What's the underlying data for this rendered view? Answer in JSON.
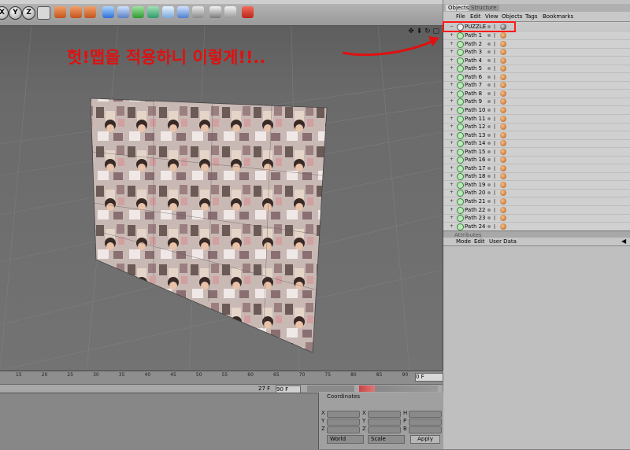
{
  "toolbar": {
    "axis_buttons": [
      "X",
      "Y",
      "Z"
    ]
  },
  "annotation": {
    "text": "헛!맵을 적용하니 이렇게!!.."
  },
  "colors": {
    "annotation": "#e01010",
    "highlight_box": "#ff1a1a",
    "path_icon": "#2f8a2f"
  },
  "object_manager": {
    "tabs": [
      "Objects",
      "Structure"
    ],
    "menu": [
      "File",
      "Edit",
      "View",
      "Objects",
      "Tags",
      "Bookmarks"
    ],
    "root": "PUZZLE",
    "items": [
      "Path 1",
      "Path 2",
      "Path 3",
      "Path 4",
      "Path 5",
      "Path 6",
      "Path 7",
      "Path 8",
      "Path 9",
      "Path 10",
      "Path 11",
      "Path 12",
      "Path 13",
      "Path 14",
      "Path 15",
      "Path 16",
      "Path 17",
      "Path 18",
      "Path 19",
      "Path 20",
      "Path 21",
      "Path 22",
      "Path 23",
      "Path 24"
    ]
  },
  "attributes": {
    "title": "Attributes",
    "menu": [
      "Mode",
      "Edit",
      "User Data"
    ]
  },
  "timeline": {
    "ticks": [
      "15",
      "20",
      "25",
      "30",
      "35",
      "40",
      "45",
      "50",
      "55",
      "60",
      "65",
      "70",
      "75",
      "80",
      "85",
      "90"
    ],
    "current_frame": "0 F",
    "end_frame": "90 F",
    "range": "27 F"
  },
  "coordinates": {
    "title": "Coordinates",
    "pos_labels": [
      "X",
      "Y",
      "Z"
    ],
    "size_labels": [
      "X",
      "Y",
      "Z"
    ],
    "rot_labels": [
      "H",
      "P",
      "B"
    ],
    "space": "World",
    "mode": "Scale",
    "apply_label": "Apply"
  },
  "icons": [
    "axis-x-icon",
    "axis-y-icon",
    "axis-z-icon",
    "cube-icon",
    "render-icon",
    "path-spline-icon",
    "material-tag-icon",
    "puzzle-object-icon"
  ]
}
